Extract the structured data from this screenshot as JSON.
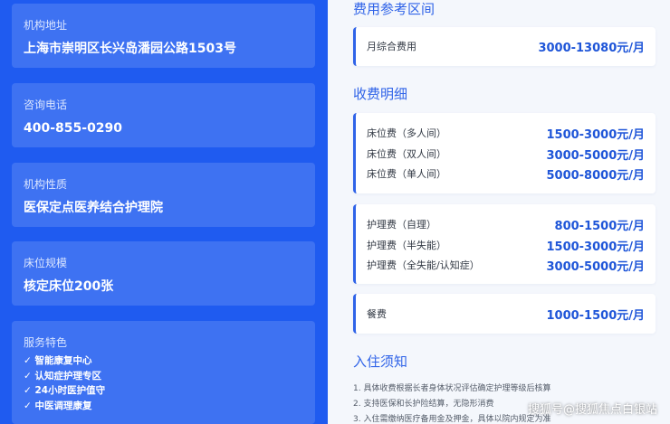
{
  "info": {
    "address": {
      "label": "机构地址",
      "value": "上海市崇明区长兴岛潘园公路1503号"
    },
    "phone": {
      "label": "咨询电话",
      "value": "400-855-0290"
    },
    "nature": {
      "label": "机构性质",
      "value": "医保定点医养结合护理院"
    },
    "beds": {
      "label": "床位规模",
      "value": "核定床位200张"
    },
    "features": {
      "label": "服务特色",
      "items": [
        "✓ 智能康复中心",
        "✓ 认知症护理专区",
        "✓ 24小时医护值守",
        "✓ 中医调理康复"
      ]
    }
  },
  "fees": {
    "reference_title": "费用参考区间",
    "reference": {
      "name": "月综合费用",
      "price": "3000-13080元/月"
    },
    "detail_title": "收费明细",
    "beds": [
      {
        "name": "床位费（多人间）",
        "price": "1500-3000元/月"
      },
      {
        "name": "床位费（双人间）",
        "price": "3000-5000元/月"
      },
      {
        "name": "床位费（单人间）",
        "price": "5000-8000元/月"
      }
    ],
    "care": [
      {
        "name": "护理费（自理）",
        "price": "800-1500元/月"
      },
      {
        "name": "护理费（半失能）",
        "price": "1500-3000元/月"
      },
      {
        "name": "护理费（全失能/认知症）",
        "price": "3000-5000元/月"
      }
    ],
    "meal": {
      "name": "餐费",
      "price": "1000-1500元/月"
    }
  },
  "notice": {
    "title": "入住须知",
    "items": [
      "1. 具体收费根据长者身体状况评估确定护理等级后核算",
      "2. 支持医保和长护险结算，无隐形消费",
      "3. 入住需缴纳医疗备用金及押金，具体以院内规定为准"
    ]
  },
  "watermark": "搜狐号@搜狐焦点白银站"
}
